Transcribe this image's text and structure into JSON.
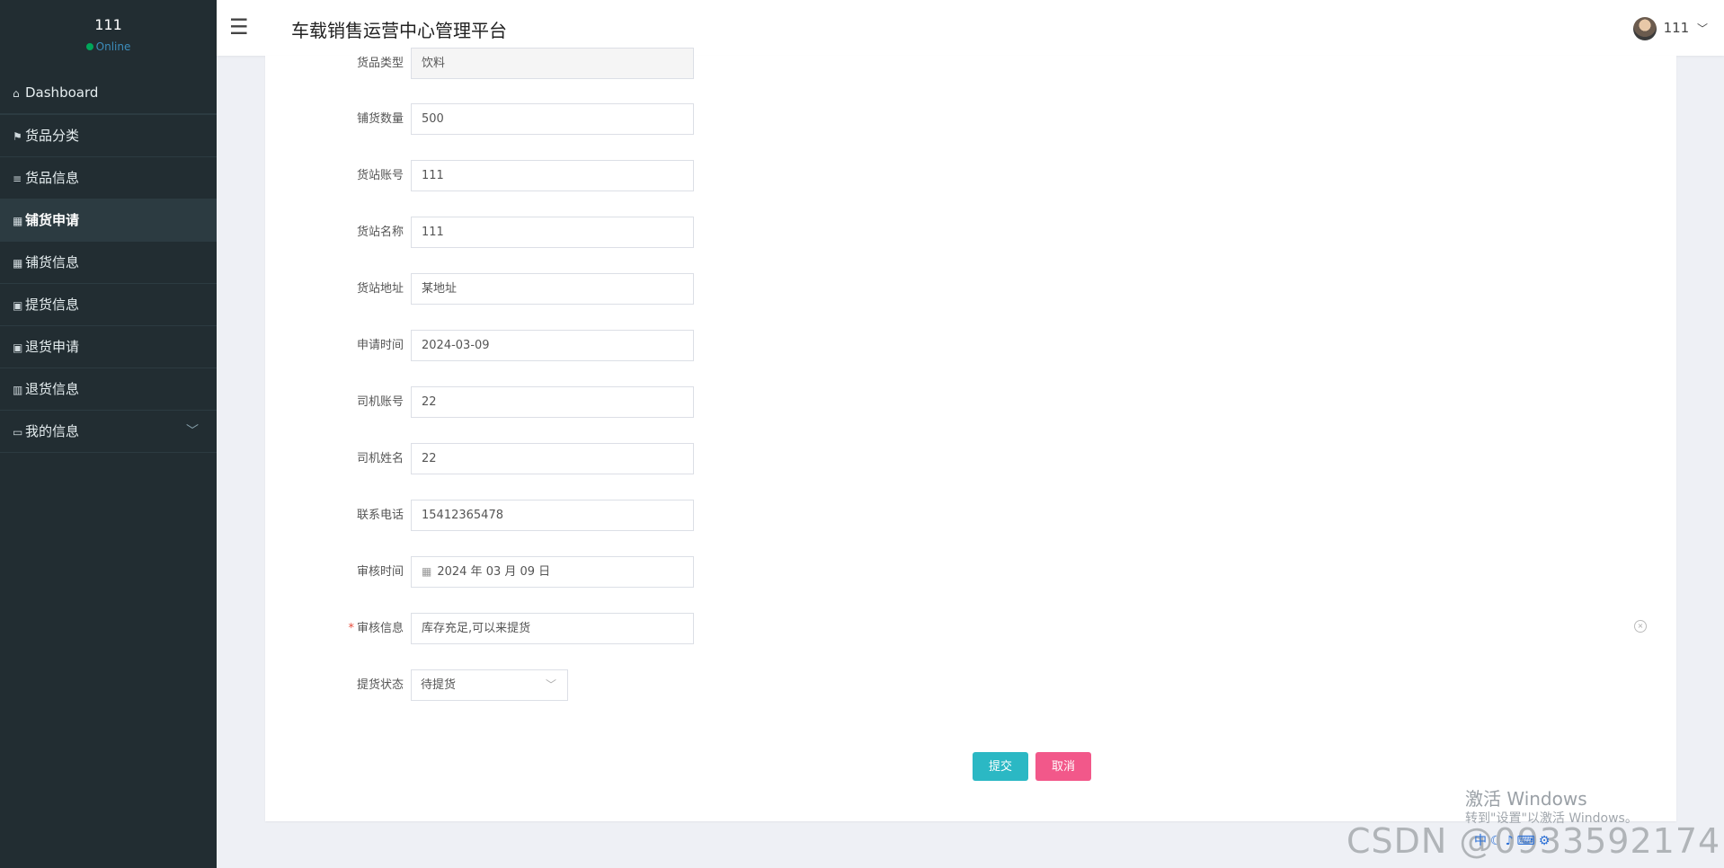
{
  "sidebar": {
    "username": "111",
    "status": "Online",
    "items": [
      {
        "icon": "⌂",
        "label": "Dashboard"
      },
      {
        "icon": "⚑",
        "label": "货品分类"
      },
      {
        "icon": "≡",
        "label": "货品信息"
      },
      {
        "icon": "▦",
        "label": "铺货申请"
      },
      {
        "icon": "▦",
        "label": "铺货信息"
      },
      {
        "icon": "▣",
        "label": "提货信息"
      },
      {
        "icon": "▣",
        "label": "退货申请"
      },
      {
        "icon": "▥",
        "label": "退货信息"
      },
      {
        "icon": "▭",
        "label": "我的信息"
      }
    ]
  },
  "header": {
    "toggle_icon": "☰",
    "title": "车载销售运营中心管理平台",
    "username": "111"
  },
  "form": {
    "goods_type": {
      "label": "货品类型",
      "value": "饮料"
    },
    "quantity": {
      "label": "铺货数量",
      "value": "500"
    },
    "station_account": {
      "label": "货站账号",
      "value": "111"
    },
    "station_name": {
      "label": "货站名称",
      "value": "111"
    },
    "station_address": {
      "label": "货站地址",
      "value": "某地址"
    },
    "apply_time": {
      "label": "申请时间",
      "value": "2024-03-09"
    },
    "driver_account": {
      "label": "司机账号",
      "value": "22"
    },
    "driver_name": {
      "label": "司机姓名",
      "value": "22"
    },
    "phone": {
      "label": "联系电话",
      "value": "15412365478"
    },
    "review_time": {
      "label": "审核时间",
      "value": "2024 年 03 月 09 日"
    },
    "review_info": {
      "label": "审核信息",
      "value": "库存充足,可以来提货"
    },
    "pickup_status": {
      "label": "提货状态",
      "value": "待提货"
    }
  },
  "buttons": {
    "submit": "提交",
    "cancel": "取消"
  },
  "overlay": {
    "activate_title": "激活 Windows",
    "activate_sub": "转到\"设置\"以激活 Windows。",
    "csdn": "CSDN @0933592174"
  },
  "colors": {
    "sidebar_bg": "#222d32",
    "submit": "#2bb8c4",
    "cancel": "#f2588a",
    "online": "#00a65a"
  }
}
